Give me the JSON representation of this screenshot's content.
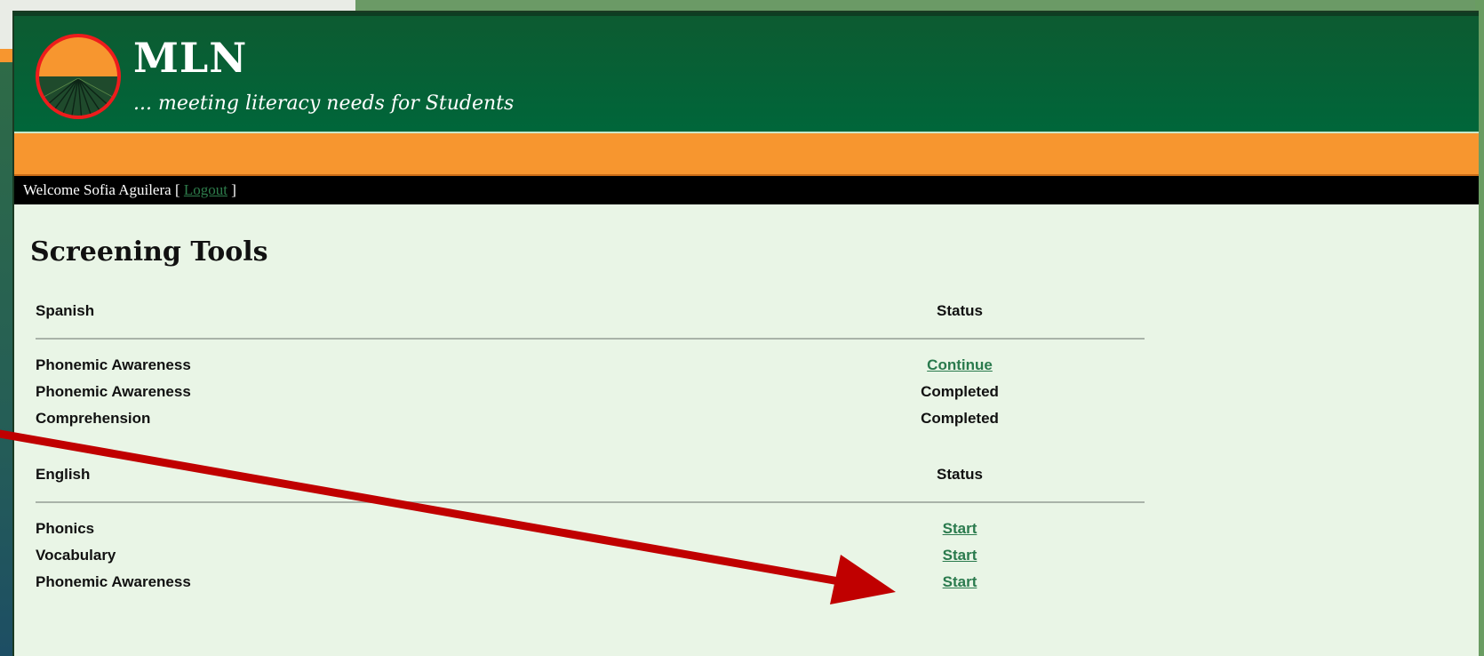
{
  "header": {
    "title": "MLN",
    "tagline": "... meeting literacy needs for Students"
  },
  "welcome": {
    "prefix": "Welcome Sofia Aguilera [ ",
    "logout_label": "Logout",
    "suffix": " ]"
  },
  "page": {
    "title": "Screening Tools"
  },
  "spanish": {
    "heading": "Spanish",
    "status_heading": "Status",
    "rows": [
      {
        "name": "Phonemic Awareness",
        "status": "Continue"
      },
      {
        "name": "Phonemic Awareness",
        "status": "Completed"
      },
      {
        "name": "Comprehension",
        "status": "Completed"
      }
    ]
  },
  "english": {
    "heading": "English",
    "status_heading": "Status",
    "rows": [
      {
        "name": "Phonics",
        "status": "Start"
      },
      {
        "name": "Vocabulary",
        "status": "Start"
      },
      {
        "name": "Phonemic Awareness",
        "status": "Start"
      }
    ]
  },
  "colors": {
    "header_green": "#006638",
    "accent_orange": "#f7962f",
    "link_green": "#2a7a4d",
    "content_bg": "#e9f5e6",
    "annotation_red": "#c00000"
  },
  "icons": {
    "logo": "sunrise-field-logo"
  }
}
